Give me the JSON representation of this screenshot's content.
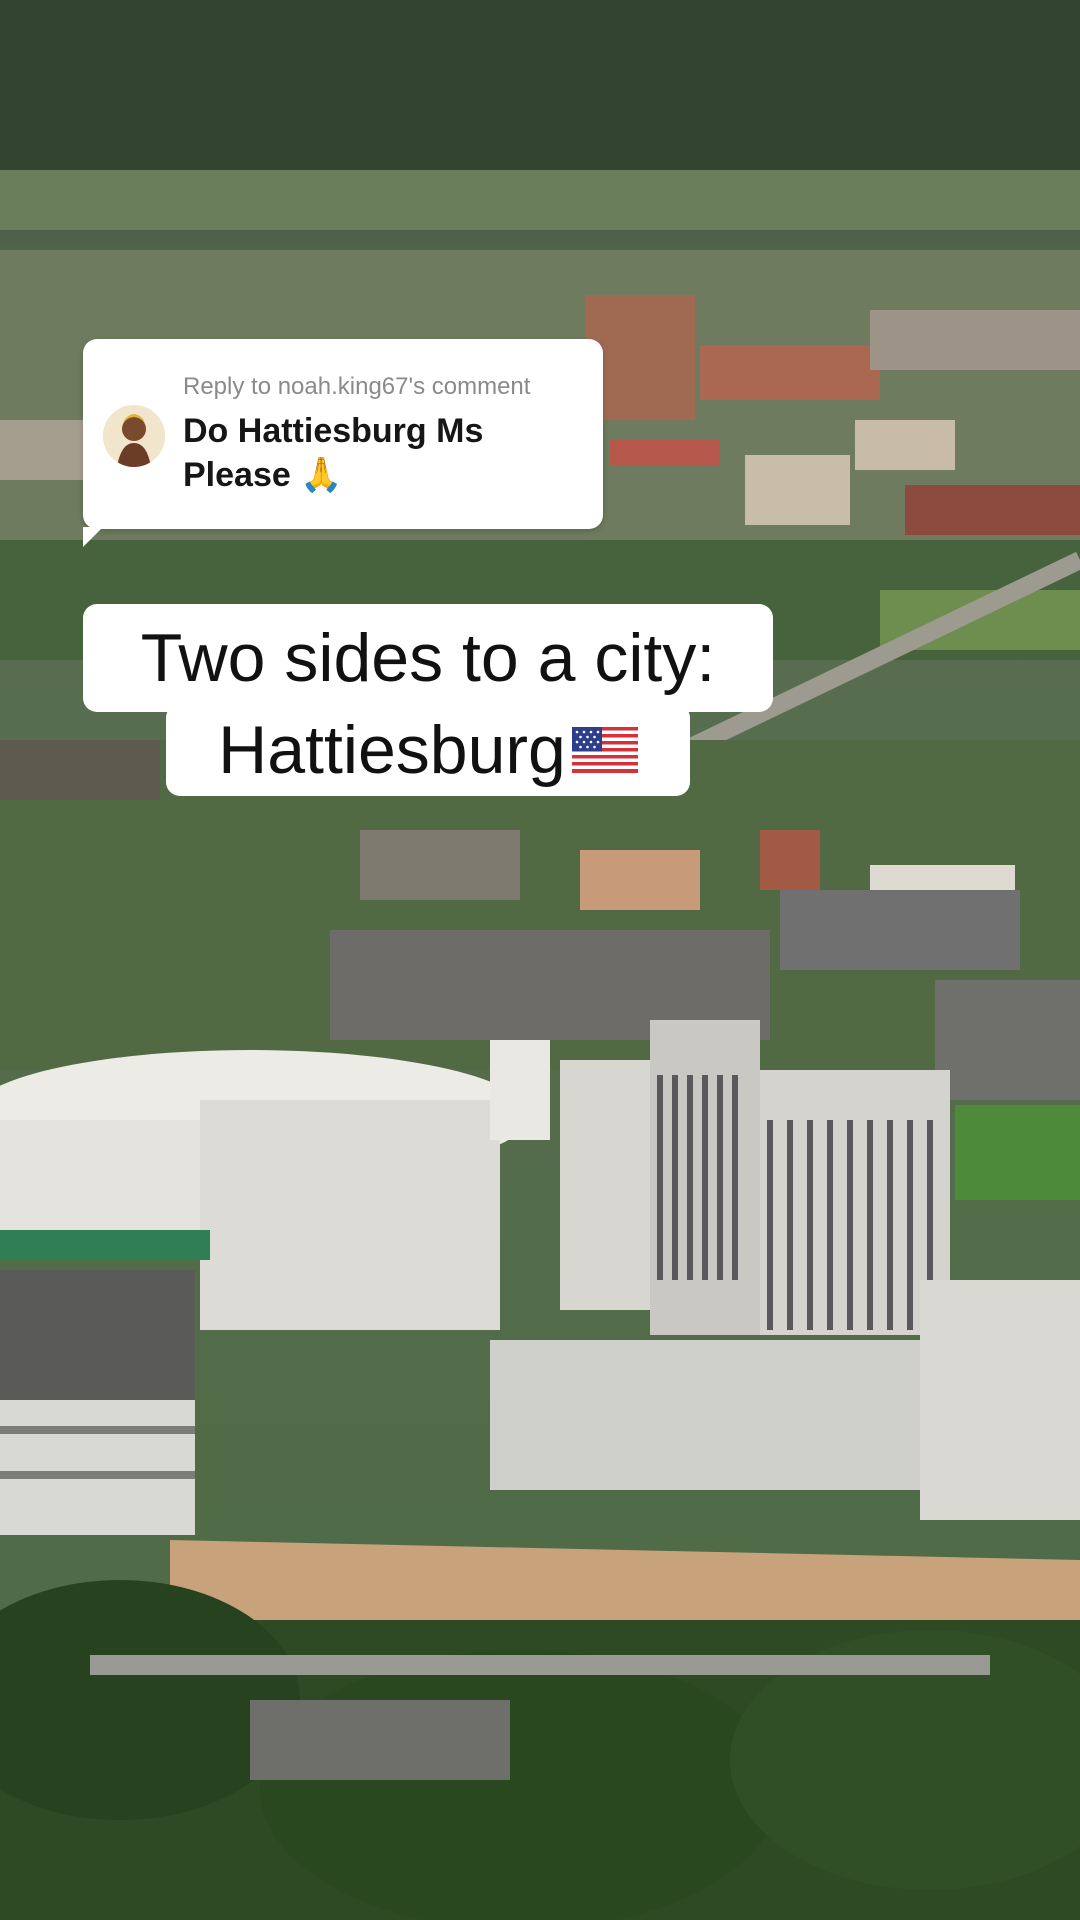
{
  "reply": {
    "header": "Reply to noah.king67's comment",
    "text": "Do Hattiesburg Ms Please 🙏"
  },
  "caption": {
    "line1": "Two sides to a city:",
    "line2": "Hattiesburg"
  },
  "icons": {
    "flag": "us-flag-icon",
    "avatar": "avatar"
  }
}
